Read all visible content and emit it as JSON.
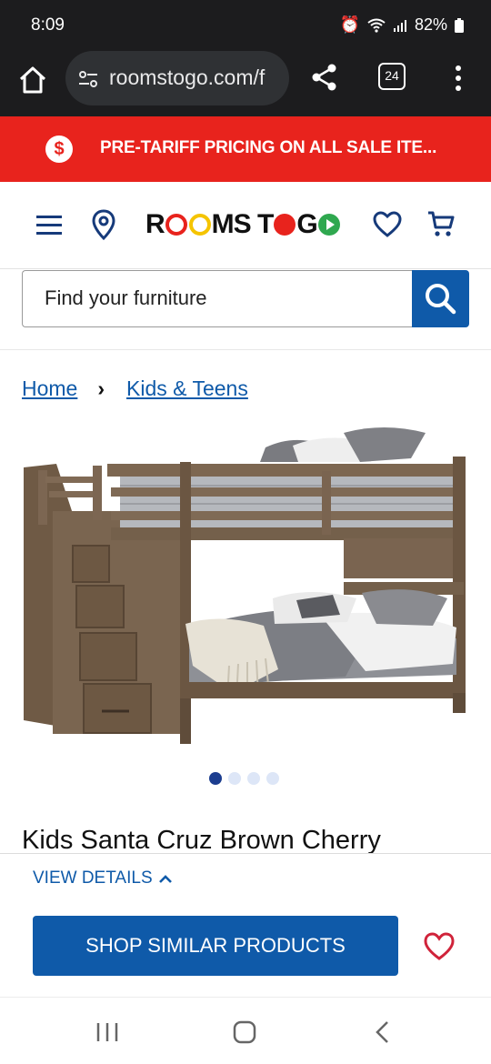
{
  "status": {
    "time": "8:09",
    "battery": "82%"
  },
  "browser": {
    "url": "roomstogo.com/f",
    "tab_count": "24"
  },
  "promo": {
    "badge": "$",
    "text": "PRE-TARIFF PRICING ON ALL SALE ITE..."
  },
  "header": {
    "logo_parts": [
      "R",
      "MS T",
      " G"
    ]
  },
  "search": {
    "placeholder": "Find your furniture"
  },
  "breadcrumb": {
    "home": "Home",
    "separator": "›",
    "category": "Kids & Teens"
  },
  "gallery": {
    "count": 4,
    "active_index": 0
  },
  "product": {
    "title": "Kids Santa Cruz Brown Cherry"
  },
  "sheet": {
    "view_details": "VIEW DETAILS",
    "shop_similar": "SHOP SIMILAR PRODUCTS"
  },
  "colors": {
    "brand_blue": "#0f5aa9",
    "promo_red": "#e8231d",
    "logo_red": "#e8231d",
    "logo_yellow": "#f5c400",
    "logo_green": "#2fa84f"
  }
}
